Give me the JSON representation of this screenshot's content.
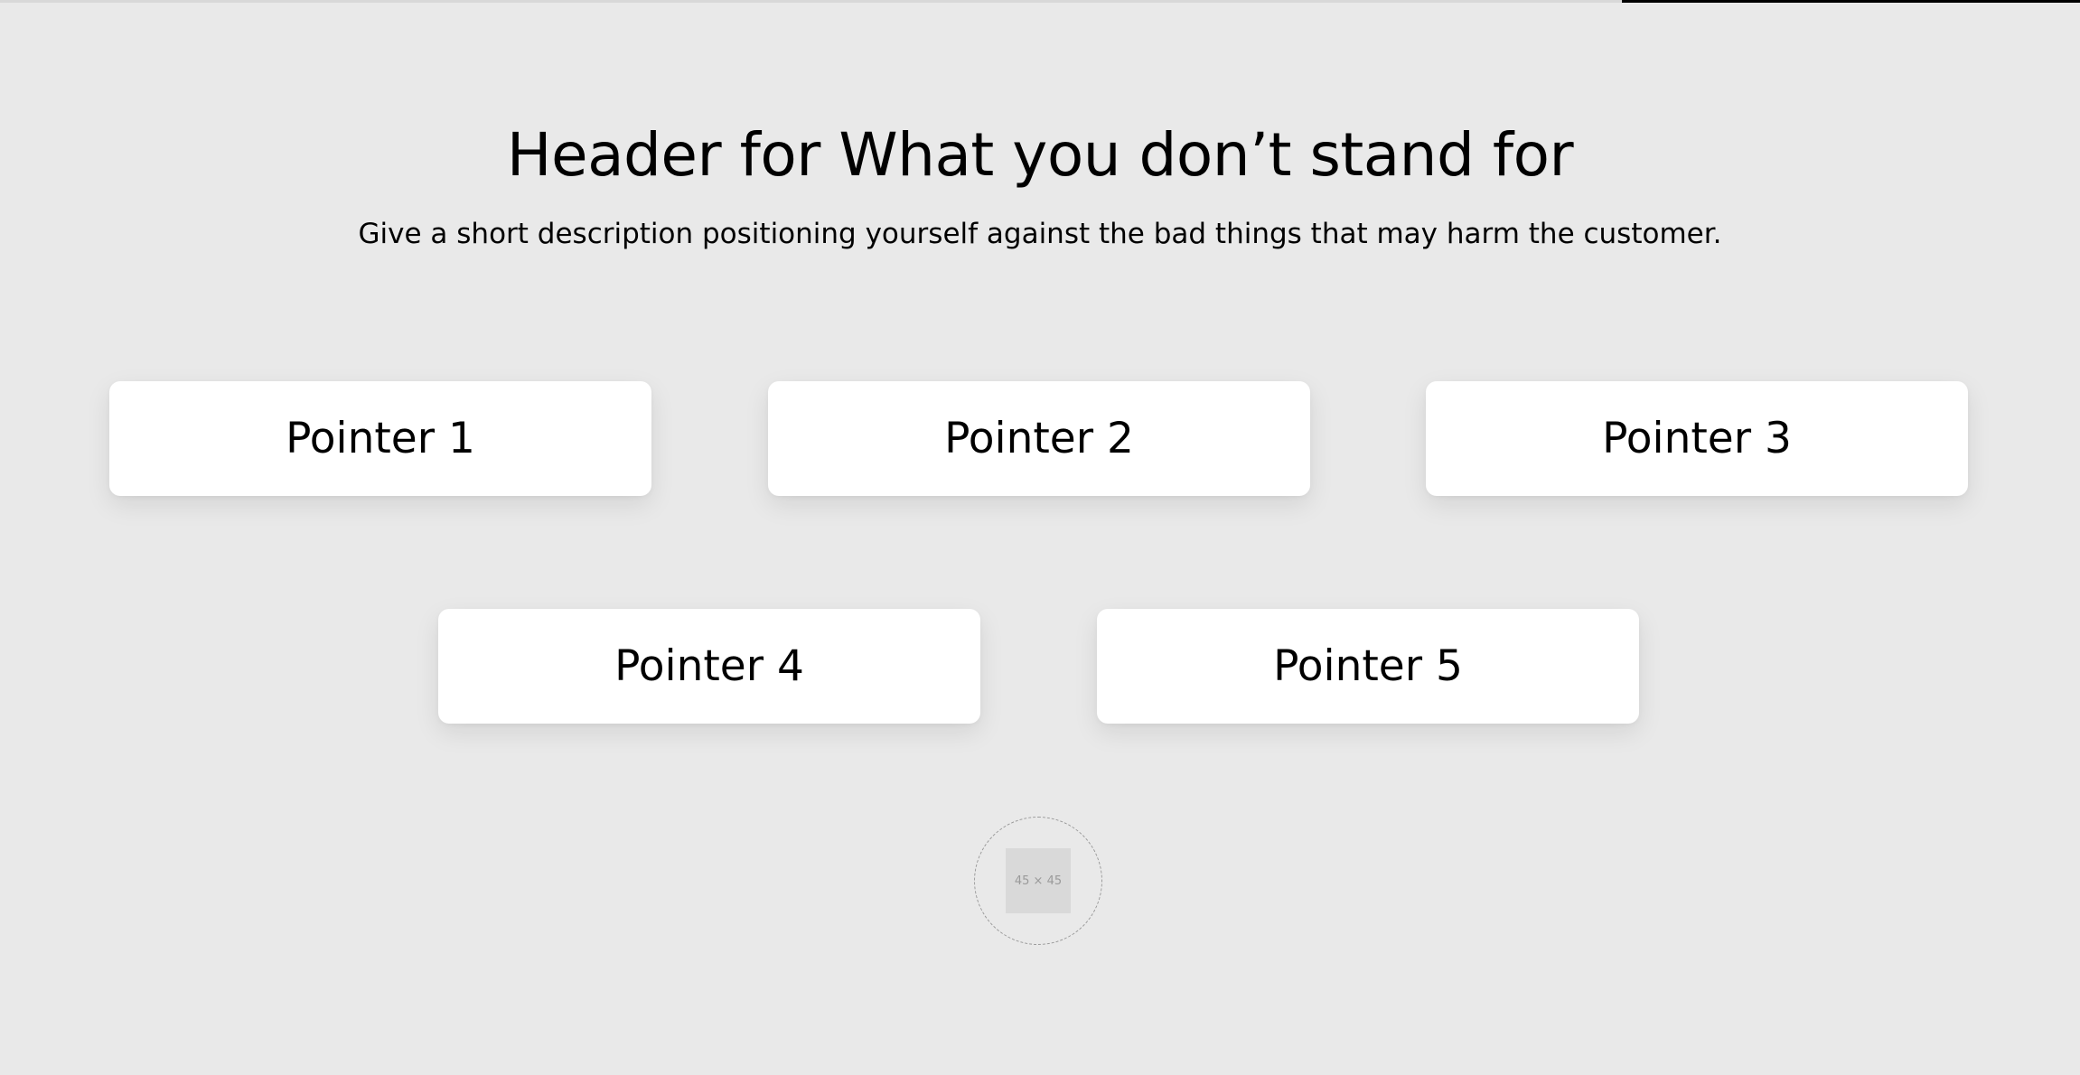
{
  "header": {
    "title": "Header for What you don’t stand for",
    "subtitle": "Give a short description positioning yourself against the bad things that may harm the customer."
  },
  "pointers": [
    {
      "label": "Pointer 1"
    },
    {
      "label": "Pointer 2"
    },
    {
      "label": "Pointer 3"
    },
    {
      "label": "Pointer 4"
    },
    {
      "label": "Pointer 5"
    }
  ],
  "logo": {
    "placeholder_text": "45 × 45"
  },
  "colors": {
    "background": "#e9e9e9",
    "card": "#ffffff",
    "text": "#000000",
    "accent_bar": "#000000"
  }
}
